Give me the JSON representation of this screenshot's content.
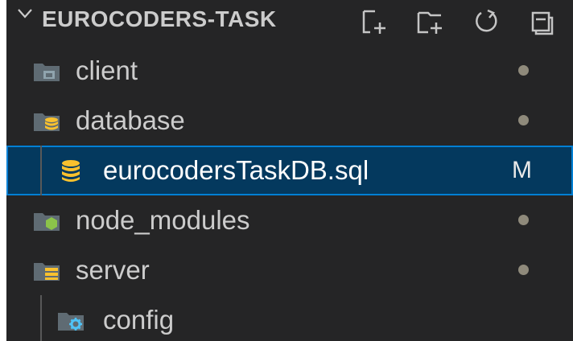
{
  "explorer": {
    "title": "EUROCODERS-TASK",
    "toolbar": {
      "new_file_icon": "new-file-icon",
      "new_folder_icon": "new-folder-icon",
      "refresh_icon": "refresh-icon",
      "collapse_icon": "collapse-all-icon"
    },
    "items": [
      {
        "label": "client",
        "icon": "folder-client-icon",
        "status": "dot"
      },
      {
        "label": "database",
        "icon": "folder-database-icon",
        "status": "dot"
      },
      {
        "label": "eurocodersTaskDB.sql",
        "icon": "database-file-icon",
        "status": "M",
        "selected": true
      },
      {
        "label": "node_modules",
        "icon": "folder-node-icon",
        "status": "dot"
      },
      {
        "label": "server",
        "icon": "folder-server-icon",
        "status": "dot"
      },
      {
        "label": "config",
        "icon": "folder-config-icon",
        "status": ""
      }
    ],
    "colors": {
      "background": "#252526",
      "selected_background": "#04395e",
      "selected_border": "#007fd4",
      "text": "#cccccc",
      "modified_dot": "#8f8a7b"
    }
  }
}
